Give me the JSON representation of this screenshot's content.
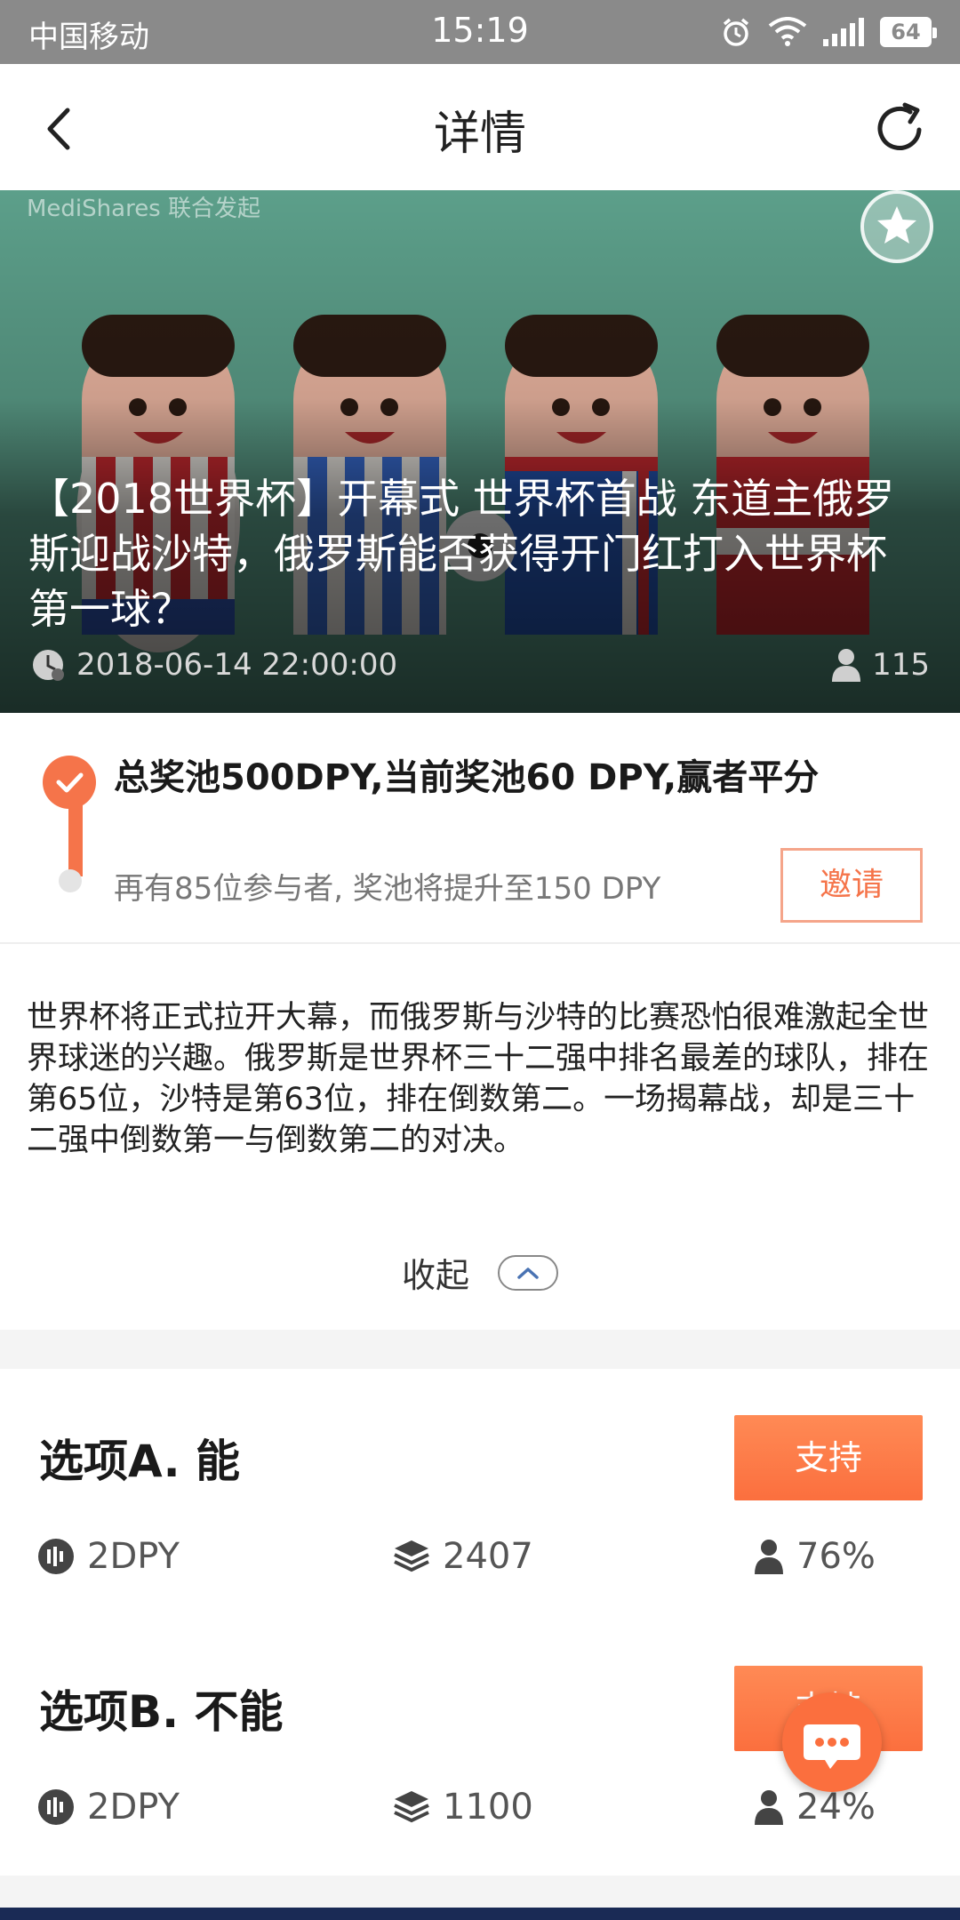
{
  "status_bar": {
    "carrier": "中国移动",
    "time": "15:19",
    "battery": "64",
    "icons": [
      "alarm-icon",
      "wifi-icon",
      "signal-icon",
      "battery-icon"
    ]
  },
  "nav": {
    "title": "详情",
    "back_icon": "back-arrow-icon",
    "refresh_icon": "refresh-icon"
  },
  "hero": {
    "watermark": "MediShares 联合发起",
    "headline": "【2018世界杯】开幕式 世界杯首战 东道主俄罗斯迎战沙特，俄罗斯能否获得开门红打入世界杯第一球？",
    "datetime": "2018-06-14 22:00:00",
    "participants": "115",
    "favorite_icon": "star-icon"
  },
  "pool": {
    "headline": "总奖池500DPY,当前奖池60 DPY,赢者平分",
    "subtext": "再有85位参与者, 奖池将提升至150 DPY",
    "invite_label": "邀请"
  },
  "description": {
    "text": "世界杯将正式拉开大幕，而俄罗斯与沙特的比赛恐怕很难激起全世界球迷的兴趣。俄罗斯是世界杯三十二强中排名最差的球队，排在第65位，沙特是第63位，排在倒数第二。一场揭幕战，却是三十二强中倒数第一与倒数第二的对决。",
    "collapse_label": "收起"
  },
  "options": [
    {
      "name": "选项A. 能",
      "support_label": "支持",
      "price": "2DPY",
      "volume": "2407",
      "share": "76%"
    },
    {
      "name": "选项B. 不能",
      "support_label": "支持",
      "price": "2DPY",
      "volume": "1100",
      "share": "24%"
    }
  ],
  "colors": {
    "accent": "#fb6f3e",
    "status_bar": "#8a8a8a"
  }
}
